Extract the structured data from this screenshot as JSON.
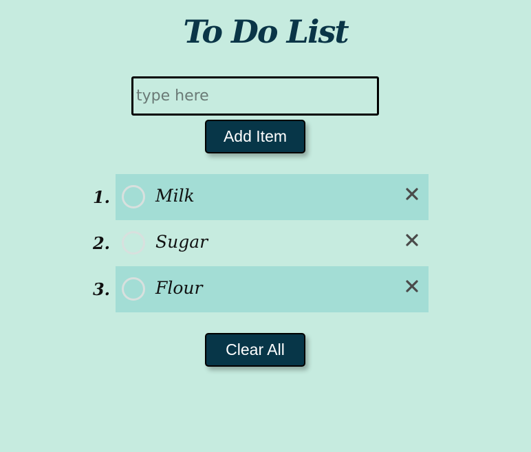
{
  "app": {
    "title": "To Do List"
  },
  "input": {
    "placeholder": "type here",
    "value": ""
  },
  "buttons": {
    "add_label": "Add Item",
    "clear_label": "Clear All"
  },
  "items": [
    {
      "number": "1.",
      "label": "Milk",
      "completed": false,
      "shaded": true
    },
    {
      "number": "2.",
      "label": "Sugar",
      "completed": false,
      "shaded": false
    },
    {
      "number": "3.",
      "label": "Flour",
      "completed": false,
      "shaded": true
    }
  ],
  "icons": {
    "checkbox": "circle-check-icon",
    "delete": "close-icon"
  },
  "colors": {
    "background": "#c6ebdf",
    "accent": "#073648",
    "row_shade": "#a3ddd5"
  }
}
